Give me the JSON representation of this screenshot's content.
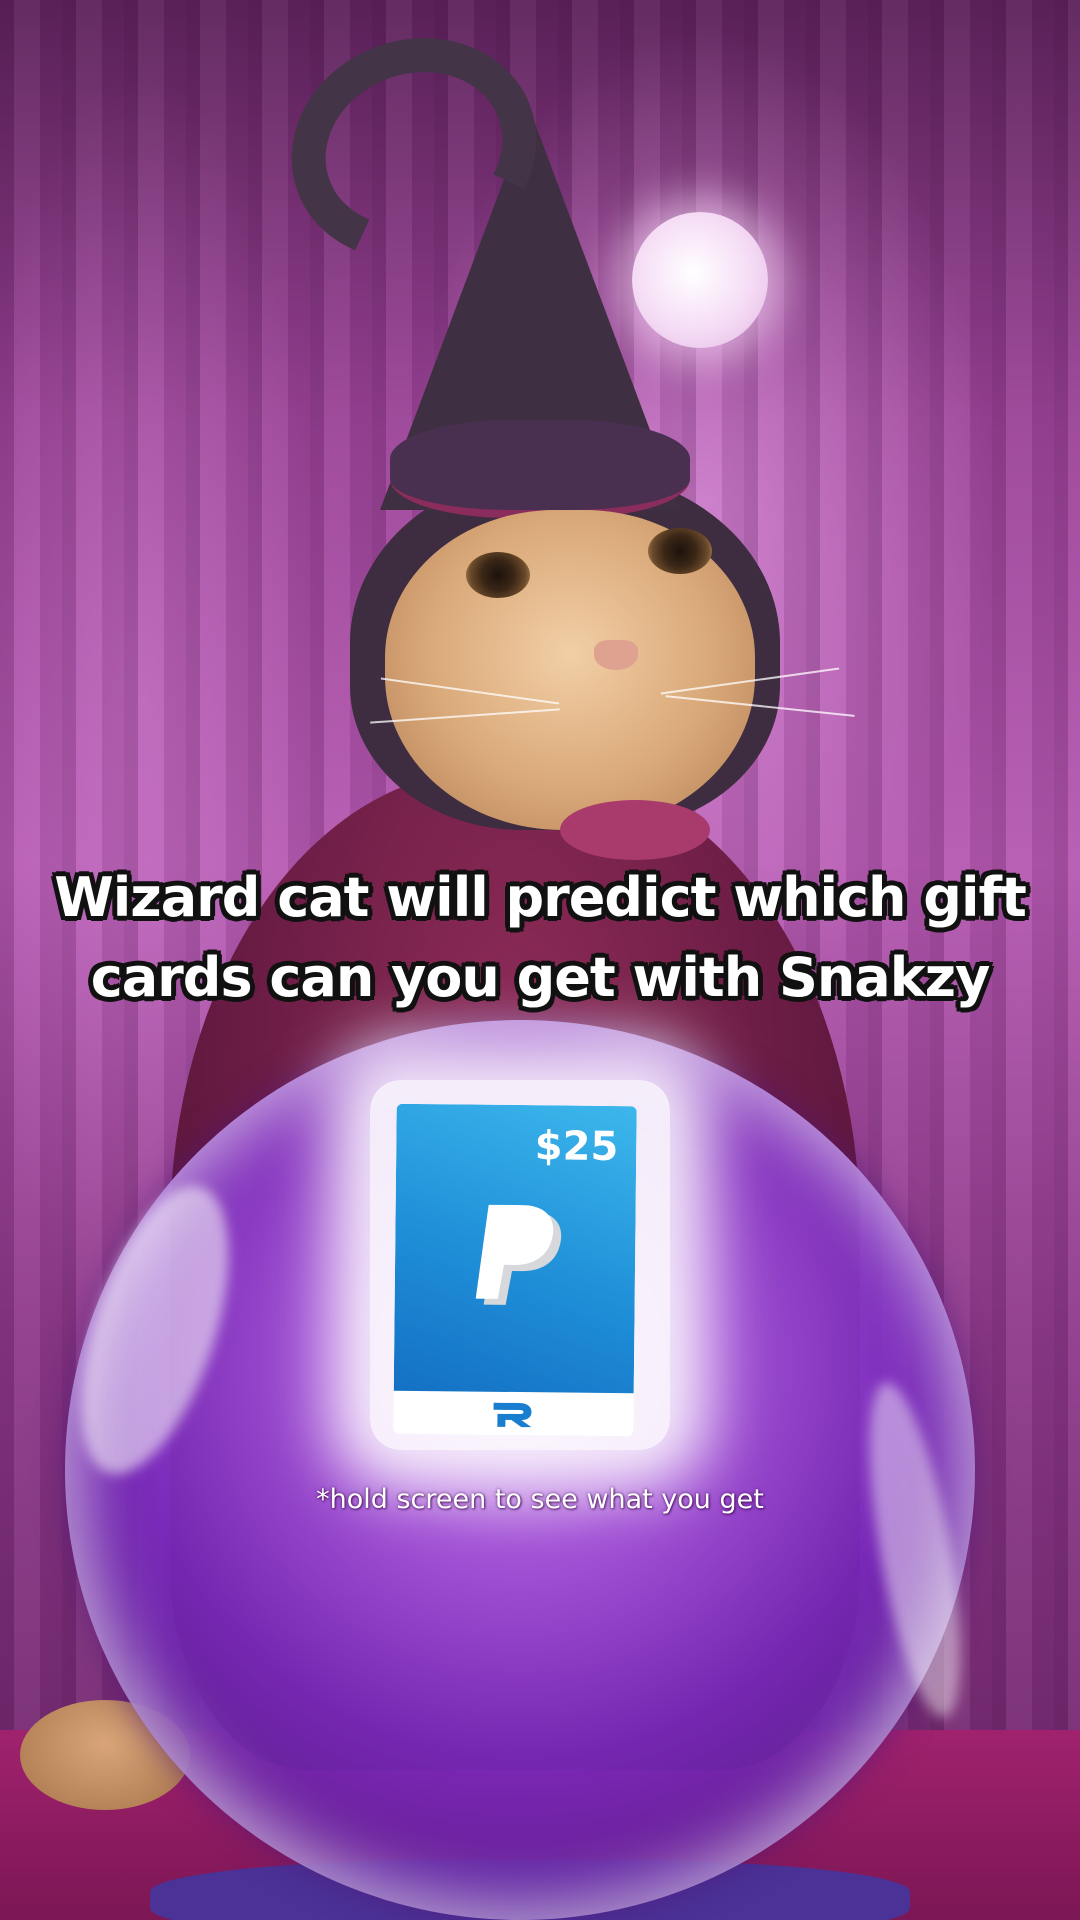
{
  "headline": {
    "line1": "Wizard cat will predict which gift",
    "line2": "cards can you get with Snakzy"
  },
  "gift_card": {
    "amount": "$25",
    "brand_icon": "paypal-logo-icon",
    "footer_icon": "r-logo-icon",
    "color": "#1f8fd8"
  },
  "hint": {
    "text": "*hold screen to see what you get"
  },
  "colors": {
    "background": "#9a4496",
    "crystal_ball": "#7a2cc0"
  }
}
